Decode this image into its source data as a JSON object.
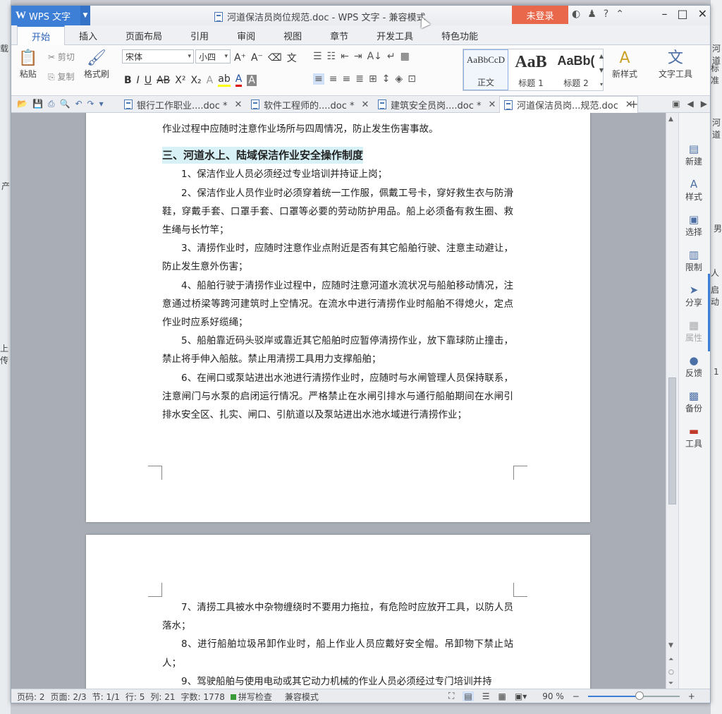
{
  "background": {
    "left_fragments": [
      "载",
      "产",
      "上传"
    ],
    "right_fragments": [
      "河道",
      "标准",
      "河道",
      "男",
      "人",
      "启动",
      "1"
    ]
  },
  "titlebar": {
    "app_name": "WPS 文字",
    "app_logo": "W",
    "title": "河道保洁员岗位规范.doc - WPS 文字 - 兼容模式",
    "login_label": "未登录",
    "help_label": "?"
  },
  "tabs": [
    "开始",
    "插入",
    "页面布局",
    "引用",
    "审阅",
    "视图",
    "章节",
    "开发工具",
    "特色功能"
  ],
  "ribbon": {
    "paste": "粘贴",
    "cut": "剪切",
    "copy": "复制",
    "format_painter": "格式刷",
    "font_name": "宋体",
    "font_size": "小四",
    "styles": [
      {
        "preview": "AaBbCcD",
        "label": "正文"
      },
      {
        "preview": "AaB",
        "label": "标题 1"
      },
      {
        "preview": "AaBb(",
        "label": "标题 2"
      }
    ],
    "new_style": "新样式",
    "text_tools": "文字工具"
  },
  "doc_tabs": [
    {
      "label": "银行工作职业....doc *"
    },
    {
      "label": "软件工程师的....doc *"
    },
    {
      "label": "建筑安全员岗....doc *"
    },
    {
      "label": "河道保洁员岗...规范.doc"
    }
  ],
  "page1": {
    "lead": "作业过程中应随时注意作业场所与四周情况，防止发生伤害事故。",
    "heading": "三、河道水上、陆域保洁作业安全操作制度",
    "paragraphs": [
      "1、保洁作业人员必须经过专业培训并持证上岗；",
      "2、保洁作业人员作业时必须穿着统一工作服，佩戴工号卡，穿好救生衣与防滑鞋，穿戴手套、口罩手套、口罩等必要的劳动防护用品。船上必须备有救生圈、救生绳与长竹竿；",
      "3、清捞作业时，应随时注意作业点附近是否有其它船舶行驶、注意主动避让，防止发生意外伤害；",
      "4、船舶行驶于清捞作业过程中，应随时注意河道水流状况与船舶移动情况，注意通过桥梁等跨河建筑时上空情况。在流水中进行清捞作业时船舶不得熄火，定点作业时应系好缆绳；",
      "5、船舶靠近码头驳岸或靠近其它船舶时应暂停清捞作业，放下靠球防止撞击，禁止将手伸入船舷。禁止用清捞工具用力支撑船舶；",
      "6、在闸口或泵站进出水池进行清捞作业时，应随时与水闸管理人员保持联系，注意闸门与水泵的启闭运行情况。严格禁止在水闸引排水与通行船舶期间在水闸引排水安全区、扎实、闸口、引航道以及泵站进出水池水域进行清捞作业；"
    ]
  },
  "page2": {
    "paragraphs": [
      "7、清捞工具被水中杂物缠绕时不要用力拖拉，有危险时应放开工具，以防人员落水；",
      "8、进行船舶垃圾吊卸作业时，船上作业人员应戴好安全帽。吊卸物下禁止站人；",
      "9、驾驶船舶与使用电动或其它动力机械的作业人员必须经过专门培训并持"
    ]
  },
  "right_panel": [
    {
      "label": "新建",
      "icon": "new-doc-icon",
      "glyph": "▤",
      "enabled": true
    },
    {
      "label": "样式",
      "icon": "style-icon",
      "glyph": "A",
      "enabled": true
    },
    {
      "label": "选择",
      "icon": "select-icon",
      "glyph": "▣",
      "enabled": true
    },
    {
      "label": "限制",
      "icon": "restrict-icon",
      "glyph": "▥",
      "enabled": true
    },
    {
      "label": "分享",
      "icon": "share-icon",
      "glyph": "➤",
      "enabled": true
    },
    {
      "label": "属性",
      "icon": "properties-icon",
      "glyph": "▦",
      "enabled": false
    },
    {
      "label": "反馈",
      "icon": "feedback-icon",
      "glyph": "●",
      "enabled": true
    },
    {
      "label": "备份",
      "icon": "backup-icon",
      "glyph": "▩",
      "enabled": true
    },
    {
      "label": "工具",
      "icon": "toolbox-icon",
      "glyph": "▬",
      "enabled": true
    }
  ],
  "status": {
    "page_no": "页码: 2",
    "pages": "页面: 2/3",
    "section": "节: 1/1",
    "row": "行: 5",
    "col": "列: 21",
    "word_count": "字数: 1778",
    "spellcheck": "拼写检查",
    "mode": "兼容模式",
    "zoom_label": "90 %",
    "zoom_value": 90
  },
  "colors": {
    "accent": "#3d7ed6",
    "login": "#e9674a",
    "heading_highlight": "#d7f1f6"
  }
}
